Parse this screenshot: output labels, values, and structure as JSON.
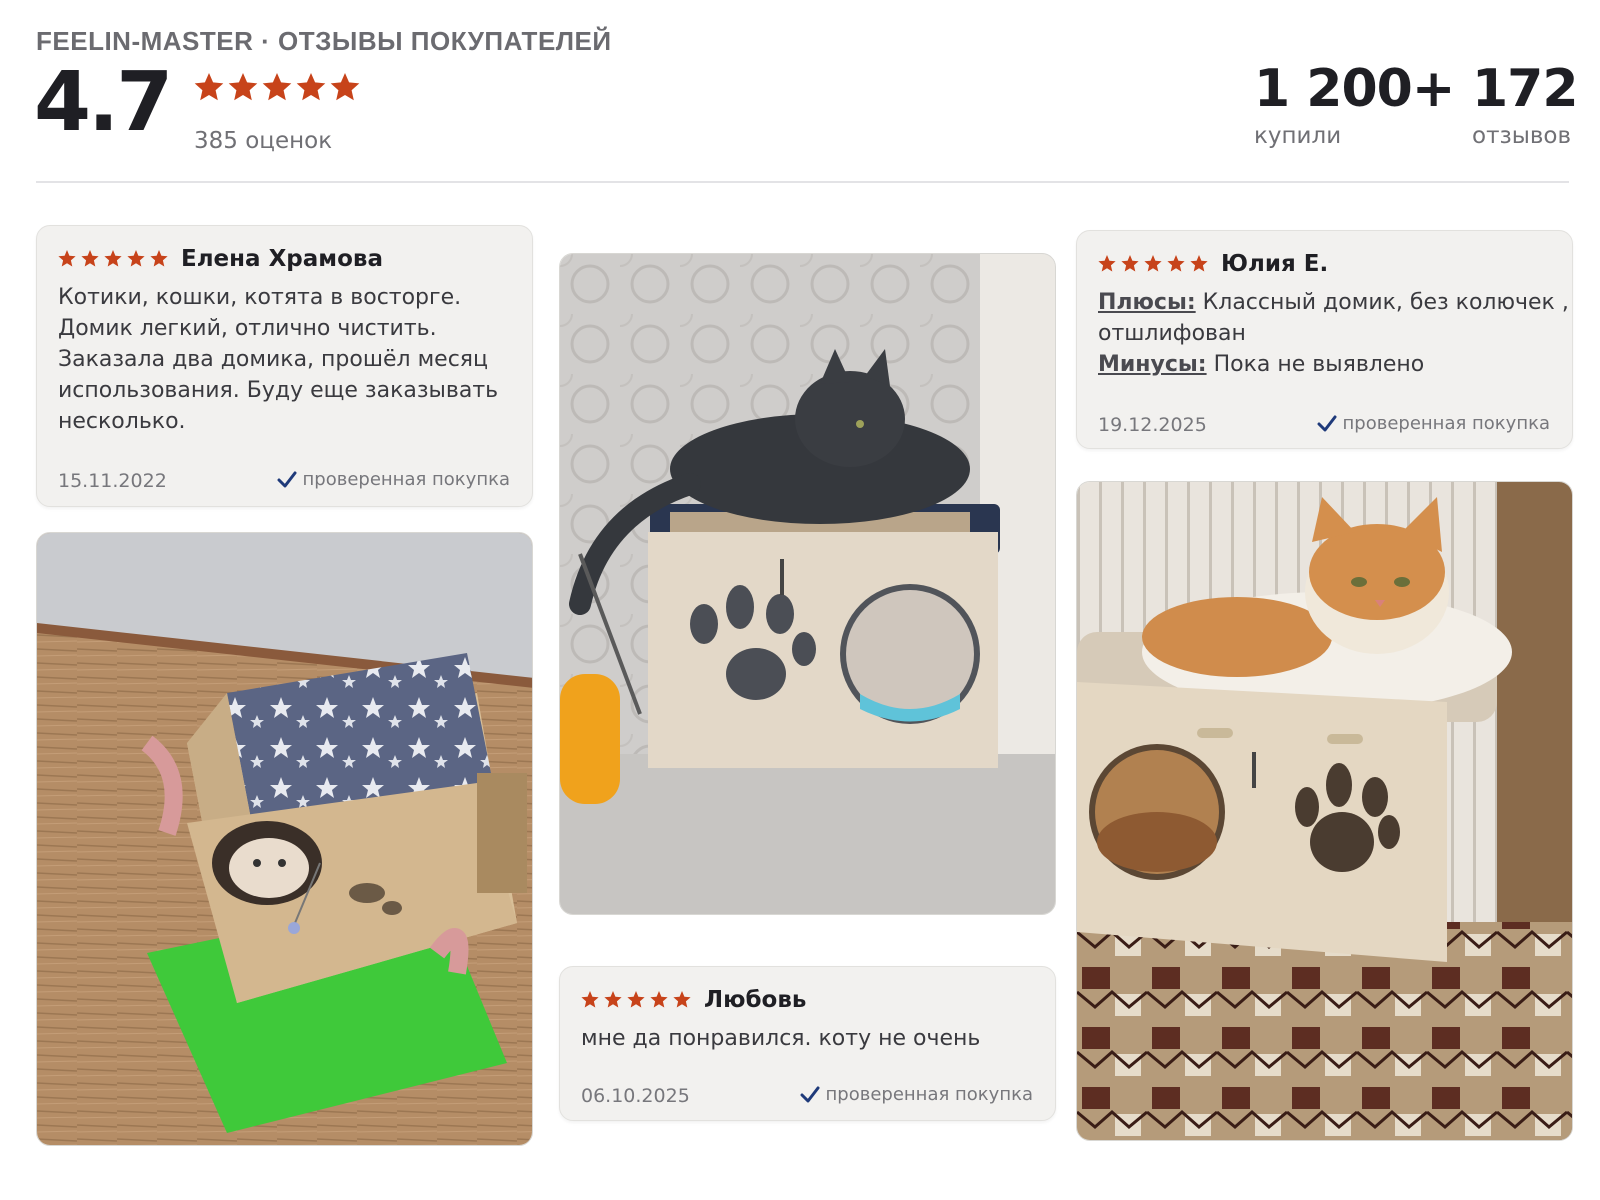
{
  "header": {
    "brand": "FEELIN-MASTER · ОТЗЫВЫ ПОКУПАТЕЛЕЙ",
    "rating": "4.7",
    "stars": 5,
    "ratings_count": "385 оценок",
    "bought_value": "1 200+",
    "bought_label": "купили",
    "reviews_value": "172",
    "reviews_label": "отзывов"
  },
  "colors": {
    "star": "#c7431a",
    "check": "#1f3a7a",
    "card_bg": "#f2f1ef"
  },
  "reviews": [
    {
      "stars": 5,
      "author": "Елена Храмова",
      "lines": [
        "Котики, кошки, котята в восторге.",
        "Домик легкий, отлично чистить.",
        "Заказала два домика, прошёл месяц",
        "использования. Буду еще заказывать",
        "несколько."
      ],
      "date": "15.11.2022",
      "verified": "проверенная покупка"
    },
    {
      "stars": 5,
      "author": "Юлия Е.",
      "pros_label": "Плюсы:",
      "pros_line1": " Классный домик, без колючек ,",
      "pros_line2": "отшлифован",
      "cons_label": "Минусы:",
      "cons_text": " Пока не выявлено",
      "date": "19.12.2025",
      "verified": "проверенная покупка"
    },
    {
      "stars": 5,
      "author": "Любовь",
      "text": "мне да понравился. коту не очень",
      "date": "06.10.2025",
      "verified": "проверенная покупка"
    }
  ],
  "photos": [
    {
      "name": "photo-kitten-box-star-blanket"
    },
    {
      "name": "photo-grey-cat-on-house"
    },
    {
      "name": "photo-ginger-cat-on-house"
    }
  ]
}
